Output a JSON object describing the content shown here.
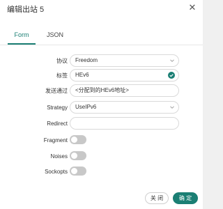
{
  "dialog": {
    "title": "编辑出站 5",
    "close_icon": "close-icon"
  },
  "tabs": [
    {
      "label": "Form",
      "active": true
    },
    {
      "label": "JSON",
      "active": false
    }
  ],
  "form": {
    "protocol": {
      "label": "协议",
      "value": "Freedom"
    },
    "tag": {
      "label": "标签",
      "value": "HEv6"
    },
    "send_through": {
      "label": "发送通过",
      "value": "<分配到的HEv6地址>"
    },
    "strategy": {
      "label": "Strategy",
      "value": "UseIPv6"
    },
    "redirect": {
      "label": "Redirect",
      "value": ""
    },
    "fragment": {
      "label": "Fragment",
      "enabled": false
    },
    "noises": {
      "label": "Noises",
      "enabled": false
    },
    "sockopts": {
      "label": "Sockopts",
      "enabled": false
    }
  },
  "footer": {
    "cancel_label": "关 闭",
    "ok_label": "确 定"
  },
  "colors": {
    "accent": "#1b7f74",
    "toggle_off": "#c8c8c8"
  }
}
